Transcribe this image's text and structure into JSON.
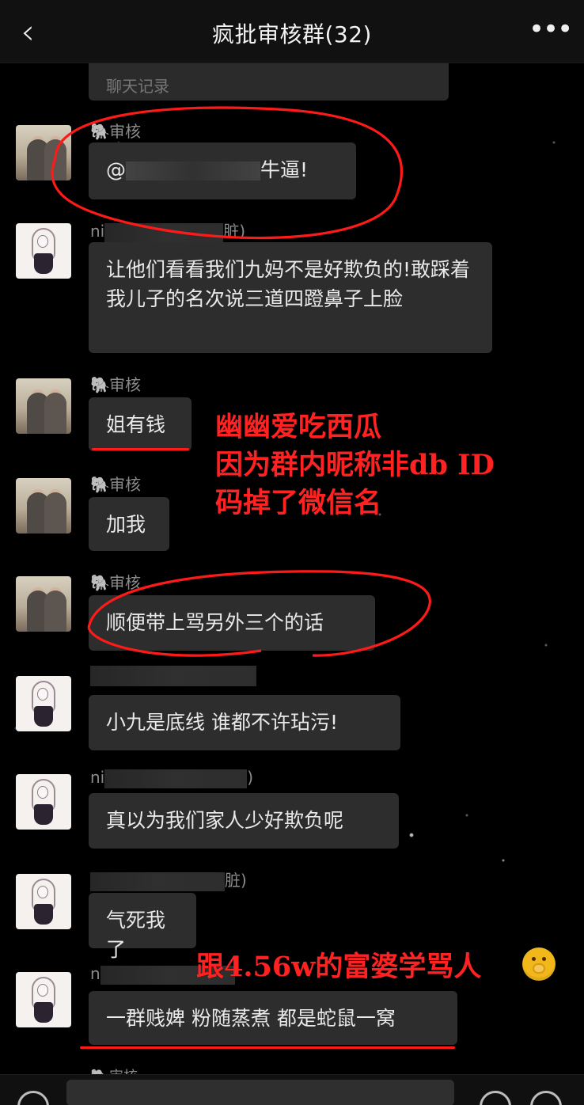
{
  "header": {
    "back_icon": "back-icon",
    "title": "疯批审核群(32)",
    "more_icon": "more-icon"
  },
  "history": {
    "label": "聊天记录"
  },
  "messages": [
    {
      "sender": "审核",
      "sender_icon": "animal-icon",
      "text_prefix": "@",
      "text_suffix": "牛逼!"
    },
    {
      "sender_prefix": "ni",
      "sender_suffix": "脏)",
      "text": "让他们看看我们九妈不是好欺负的!敢踩着我儿子的名次说三道四蹬鼻子上脸"
    },
    {
      "sender": "审核",
      "sender_icon": "animal-icon",
      "text": "姐有钱"
    },
    {
      "sender": "审核",
      "sender_icon": "animal-icon",
      "text": "加我"
    },
    {
      "sender": "审核",
      "sender_icon": "animal-icon",
      "text": "顺便带上骂另外三个的话"
    },
    {
      "text": "小九是底线 谁都不许玷污!"
    },
    {
      "sender_prefix": "ni",
      "sender_suffix": ")",
      "text": "真以为我们家人少好欺负呢"
    },
    {
      "sender_suffix": "脏)",
      "text": "气死我了"
    },
    {
      "sender_prefix": "n",
      "text": "一群贱婢 粉随蒸煮 都是蛇鼠一窝"
    }
  ],
  "annotations": {
    "line1": "幽幽爱吃西瓜",
    "line2": "因为群内昵称非db ID",
    "line3": "码掉了微信名",
    "bottom_note": "跟4.56w的富婆学骂人",
    "emoji_icon": "face-with-hand-over-mouth-icon"
  },
  "partial_sender": {
    "text": "审核"
  },
  "input": {
    "voice_icon": "voice-icon",
    "emoji_icon": "emoji-icon",
    "add_icon": "add-icon"
  },
  "colors": {
    "annotation_red": "#ff2222",
    "bubble": "#2d2d2d",
    "background": "#000000"
  }
}
